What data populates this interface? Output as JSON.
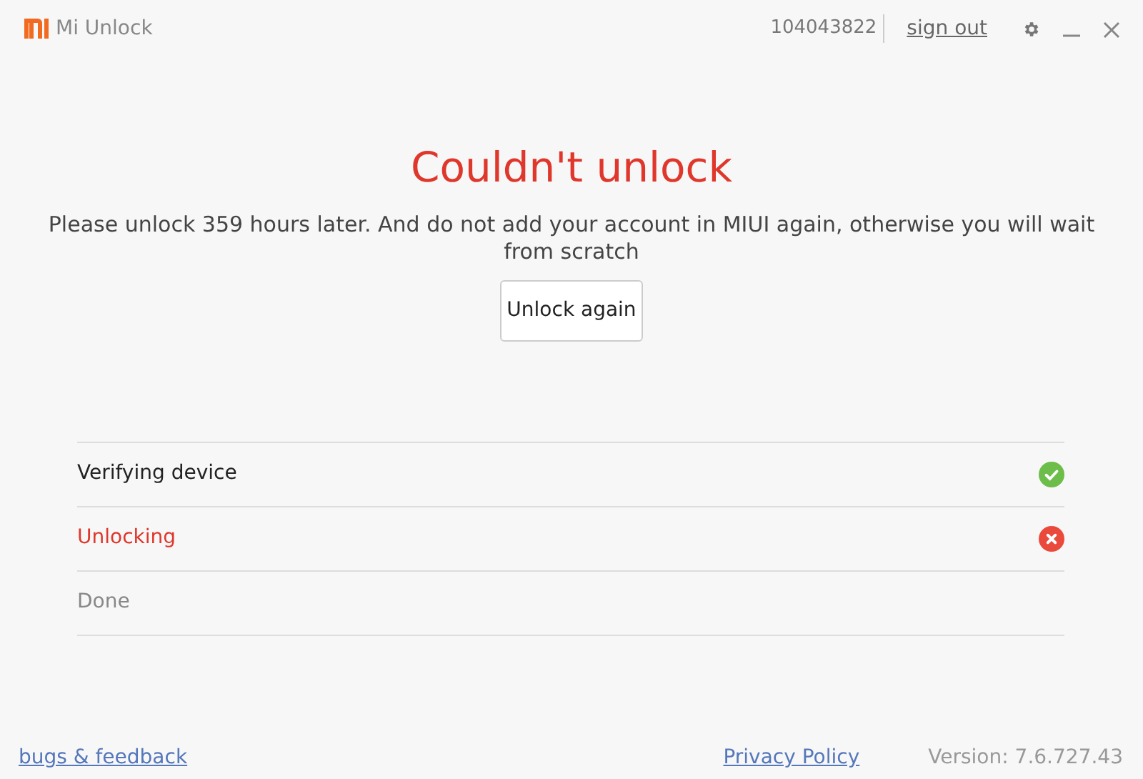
{
  "app": {
    "title": "Mi Unlock"
  },
  "header": {
    "account": "104043822",
    "sign_out": "sign out"
  },
  "result": {
    "title": "Couldn't unlock",
    "message": "Please unlock 359 hours later. And do not add your account in MIUI again, otherwise you will wait from scratch",
    "button": "Unlock again"
  },
  "steps": [
    {
      "label": "Verifying device",
      "kind": "done"
    },
    {
      "label": "Unlocking",
      "kind": "failed"
    },
    {
      "label": "Done",
      "kind": "pending"
    }
  ],
  "footer": {
    "feedback": "bugs & feedback",
    "privacy": "Privacy Policy",
    "version": "Version: 7.6.727.43"
  }
}
